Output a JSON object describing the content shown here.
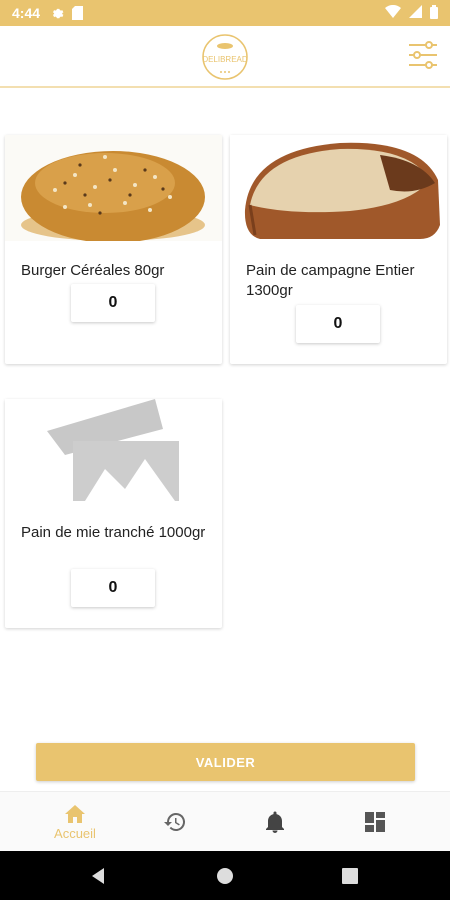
{
  "status_bar": {
    "time": "4:44"
  },
  "header": {
    "logo_alt": "DELIBREAD"
  },
  "products": [
    {
      "name": "Burger Céréales 80gr",
      "quantity": "0",
      "image": "burger-bun"
    },
    {
      "name": "Pain de campagne Entier 1300gr",
      "quantity": "0",
      "image": "country-loaf"
    },
    {
      "name": "Pain de mie tranché 1000gr",
      "quantity": "0",
      "image": "placeholder-image"
    }
  ],
  "validate_label": "VALIDER",
  "bottom_nav": [
    {
      "label": "Accueil",
      "icon": "home-icon",
      "active": true
    },
    {
      "label": "",
      "icon": "history-icon"
    },
    {
      "label": "",
      "icon": "bell-icon"
    },
    {
      "label": "",
      "icon": "dashboard-icon"
    }
  ],
  "colors": {
    "accent": "#e9c46f"
  }
}
